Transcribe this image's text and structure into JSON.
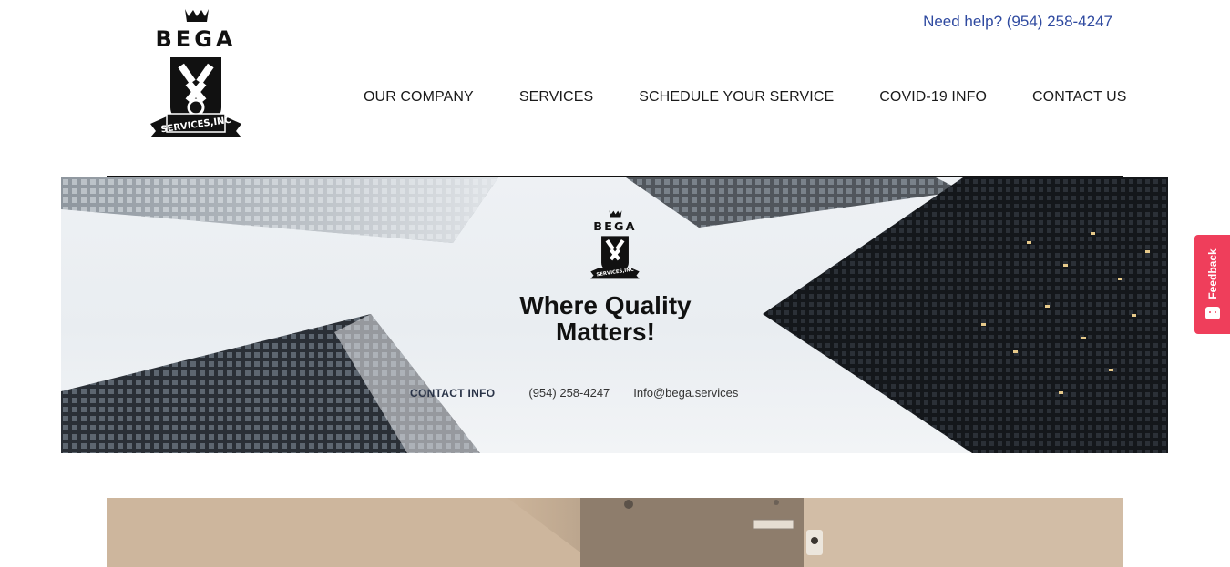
{
  "header": {
    "logo_text": "BEGA",
    "logo_banner": "SERVICES,INC",
    "help_text": "Need help? (954) 258-4247",
    "nav": [
      {
        "label": "OUR COMPANY"
      },
      {
        "label": "SERVICES"
      },
      {
        "label": "SCHEDULE YOUR SERVICE"
      },
      {
        "label": "COVID-19 INFO"
      },
      {
        "label": "CONTACT US"
      }
    ]
  },
  "hero": {
    "tagline_line1": "Where Quality",
    "tagline_line2": "Matters!",
    "contact_label": "CONTACT INFO",
    "phone": "(954) 258-4247",
    "email": "Info@bega.services"
  },
  "feedback": {
    "label": "Feedback"
  },
  "colors": {
    "help_link": "#2f4aa0",
    "feedback_tab": "#ef3e5b",
    "text": "#1a1a1a"
  }
}
